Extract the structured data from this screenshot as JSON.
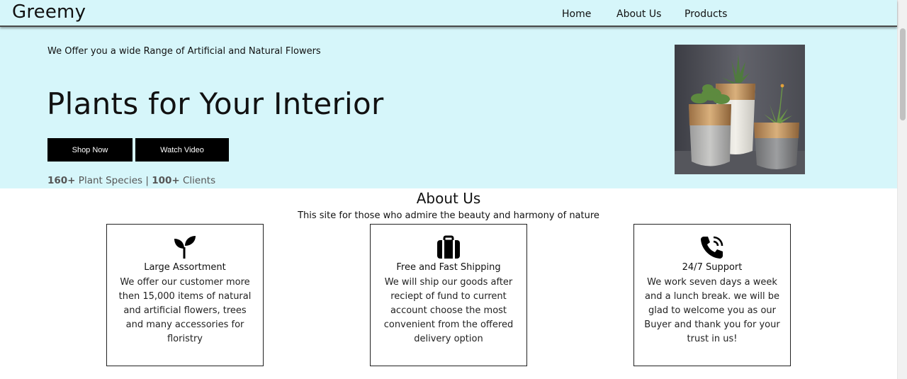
{
  "nav": {
    "logo": "Greemy",
    "links": [
      "Home",
      "About Us",
      "Products"
    ]
  },
  "hero": {
    "tagline": "We Offer you a wide Range of Artificial and Natural Flowers",
    "title": "Plants for Your Interior",
    "buttons": {
      "shop": "Shop Now",
      "video": "Watch Video"
    },
    "stats": {
      "species_count": "160+",
      "species_label": "Plant Species |",
      "clients_count": "100+",
      "clients_label": "Clients"
    }
  },
  "about": {
    "title": "About Us",
    "subtitle": "This site for those who admire the beauty and harmony of nature",
    "cards": [
      {
        "icon": "sprout-icon",
        "title": "Large Assortment",
        "text": "We offer our customer more then 15,000 items of natural and artificial flowers, trees and many accessories for floristry"
      },
      {
        "icon": "suitcase-icon",
        "title": "Free and Fast Shipping",
        "text": "We will ship our goods after reciept of fund to current account choose the most convenient from the offered delivery option"
      },
      {
        "icon": "phone-call-icon",
        "title": "24/7 Support",
        "text": "We work seven days a week and a lunch break. we will be glad to welcome you as our Buyer and thank you for your trust in us!"
      }
    ]
  },
  "colors": {
    "hero_background": "#d6f6fa",
    "button_background": "#000000",
    "button_text": "#ffffff"
  }
}
